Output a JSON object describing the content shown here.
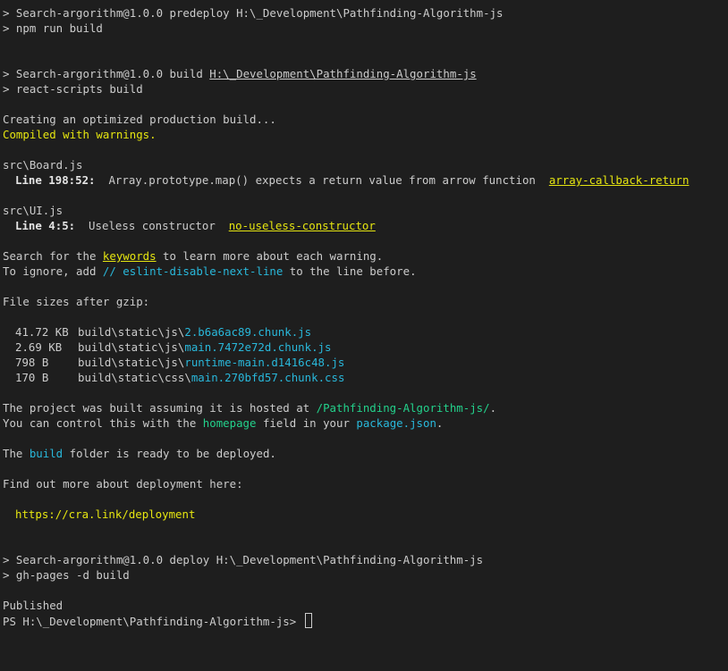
{
  "window": {
    "background": "#1e1e1e",
    "foreground": "#cccccc"
  },
  "colors": {
    "warning": "#e5e510",
    "link": "#29b8db",
    "green": "#23d18b"
  },
  "predeploy": {
    "header": "> Search-argorithm@1.0.0 predeploy H:\\_Development\\Pathfinding-Algorithm-js",
    "cmd": "> npm run build"
  },
  "build": {
    "header_prefix": "> Search-argorithm@1.0.0 build ",
    "header_path": "H:\\_Development\\Pathfinding-Algorithm-js",
    "cmd": "> react-scripts build"
  },
  "creating": "Creating an optimized production build...",
  "compiled": "Compiled with warnings.",
  "warnings": [
    {
      "file": "src\\Board.js",
      "line_label": "Line 198:52:",
      "message": "  Array.prototype.map() expects a return value from arrow function  ",
      "rule": "array-callback-return"
    },
    {
      "file": "src\\UI.js",
      "line_label": "Line 4:5:",
      "message": "  Useless constructor  ",
      "rule": "no-useless-constructor"
    }
  ],
  "search": {
    "prefix": "Search for the ",
    "keyword": "keywords",
    "suffix": " to learn more about each warning."
  },
  "ignore": {
    "prefix": "To ignore, add ",
    "comment": "// eslint-disable-next-line",
    "suffix": " to the line before."
  },
  "sizes_title": "File sizes after gzip:",
  "files": [
    {
      "size": "41.72 KB",
      "dir": "build\\static\\js\\",
      "name": "2.b6a6ac89.chunk.js"
    },
    {
      "size": "2.69 KB",
      "dir": "build\\static\\js\\",
      "name": "main.7472e72d.chunk.js"
    },
    {
      "size": "798 B",
      "dir": "build\\static\\js\\",
      "name": "runtime-main.d1416c48.js"
    },
    {
      "size": "170 B",
      "dir": "build\\static\\css\\",
      "name": "main.270bfd57.chunk.css"
    }
  ],
  "hosted": {
    "prefix": "The project was built assuming it is hosted at ",
    "path": "/Pathfinding-Algorithm-js/",
    "suffix": "."
  },
  "control": {
    "prefix": "You can control this with the ",
    "field": "homepage",
    "middle": " field in your ",
    "file": "package.json",
    "suffix": "."
  },
  "ready": {
    "prefix": "The ",
    "folder": "build",
    "suffix": " folder is ready to be deployed."
  },
  "findout": "Find out more about deployment here:",
  "link": "https://cra.link/deployment",
  "deploy": {
    "header": "> Search-argorithm@1.0.0 deploy H:\\_Development\\Pathfinding-Algorithm-js",
    "cmd": "> gh-pages -d build"
  },
  "published": "Published",
  "prompt": "PS H:\\_Development\\Pathfinding-Algorithm-js> "
}
